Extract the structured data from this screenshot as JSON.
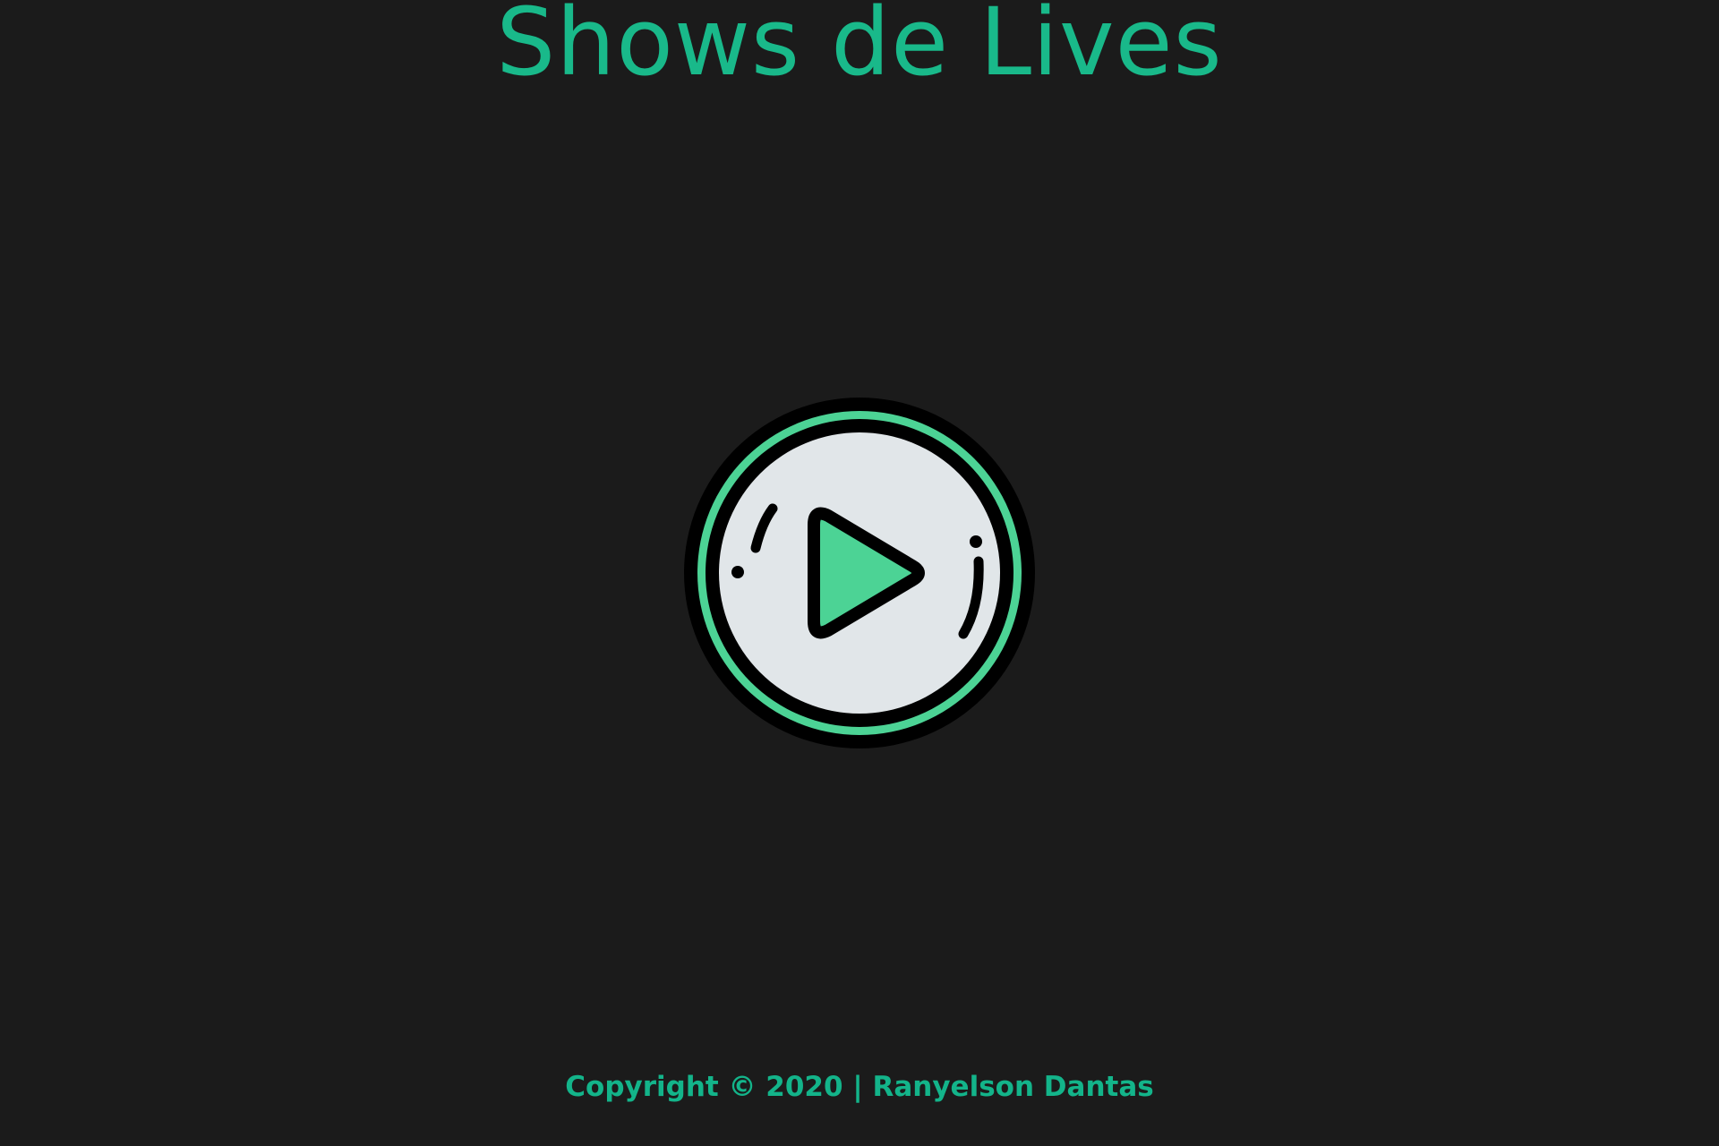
{
  "header": {
    "title": "Shows de Lives"
  },
  "main": {
    "play_button_icon": "play-circle-icon"
  },
  "footer": {
    "copyright": "Copyright © 2020 | Ranyelson Dantas"
  },
  "colors": {
    "background": "#1b1b1b",
    "accent": "#19b98a",
    "icon_green": "#4cd395",
    "icon_light": "#e1e6e9",
    "icon_outline": "#000000"
  }
}
